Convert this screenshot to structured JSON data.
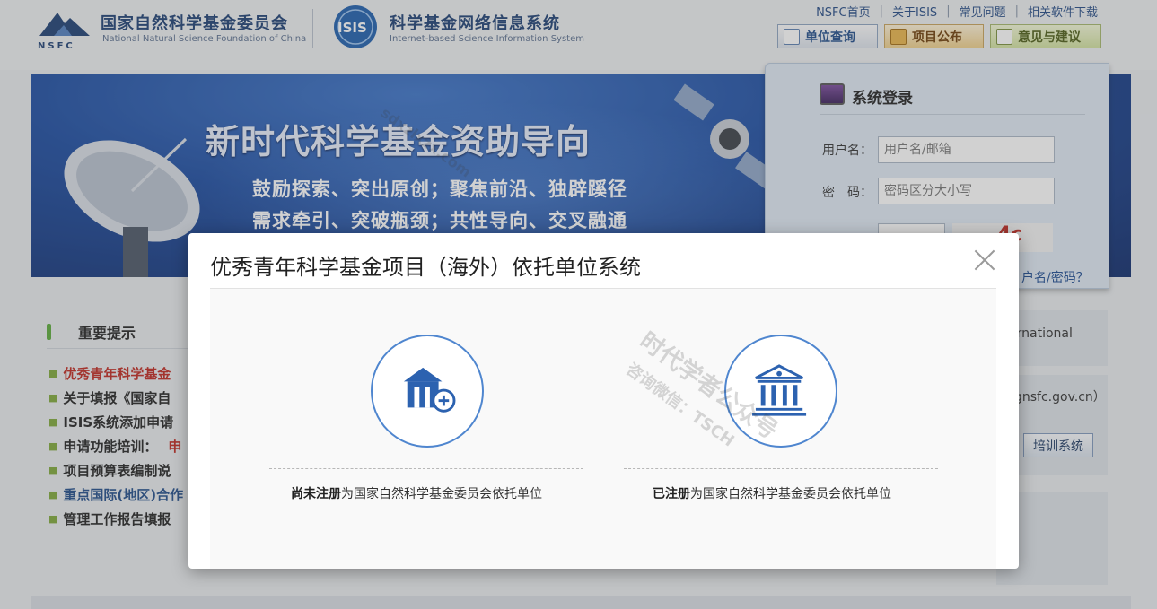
{
  "header": {
    "nsfc_name_cn": "国家自然科学基金委员会",
    "nsfc_name_en": "National Natural Science Foundation of China",
    "nsfc_logo_text": "NSFC",
    "isis_logo_text": "ISIS",
    "isis_name_cn": "科学基金网络信息系统",
    "isis_name_en": "Internet-based Science Information System",
    "top_links": [
      "NSFC首页",
      "关于ISIS",
      "常见问题",
      "相关软件下载"
    ],
    "buttons": {
      "query": "单位查询",
      "projects": "项目公布",
      "advice": "意见与建议"
    }
  },
  "banner": {
    "title": "新时代科学基金资助导向",
    "line1": "鼓励探索、突出原创；聚焦前沿、独辟蹊径",
    "line2": "需求牵引、突破瓶颈；共性导向、交叉融通"
  },
  "login": {
    "title": "系统登录",
    "username_label": "用户名：",
    "username_placeholder": "用户名/邮箱",
    "password_label": "密　码：",
    "password_placeholder": "密码区分大小写",
    "captcha_text": "4c",
    "forgot_link": "户名/密码？"
  },
  "notices": {
    "title": "重要提示",
    "items": [
      "优秀青年科学基金",
      "关于填报《国家自",
      "ISIS系统添加申请",
      "申请功能培训：",
      "项目预算表编制说",
      "重点国际(地区)合作",
      "管理工作报告填报"
    ],
    "items_suffix": [
      "",
      "",
      "",
      "申",
      "",
      "",
      ""
    ]
  },
  "side": {
    "text1": "ernational",
    "text2": "gnsfc.gov.cn）",
    "training_button": "培训系统"
  },
  "modal": {
    "title": "优秀青年科学基金项目（海外）依托单位系统",
    "option_unregistered_bold": "尚未注册",
    "option_unregistered_rest": "为国家自然科学基金委员会依托单位",
    "option_registered_bold": "已注册",
    "option_registered_rest": "为国家自然科学基金委员会依托单位"
  },
  "watermark": {
    "line1": "时代学者公众号",
    "line2": "咨询微信：TSCH",
    "line3": "sdxzlxzx.com"
  },
  "colors": {
    "accent_blue": "#4f86cf",
    "brand_navy": "#1d3f73",
    "notice_red": "#c0281f"
  }
}
